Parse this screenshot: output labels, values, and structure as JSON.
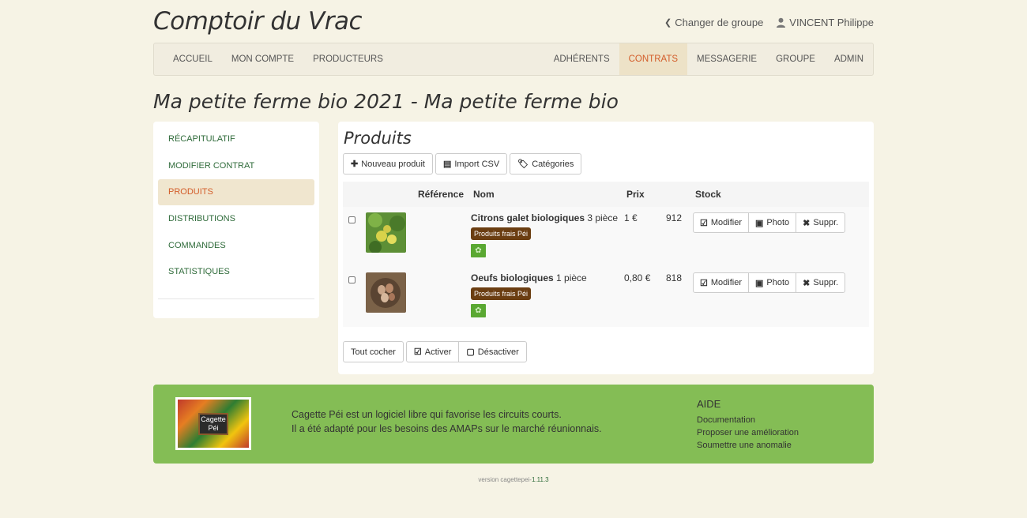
{
  "brand": "Comptoir du Vrac",
  "top_links": {
    "change_group": "Changer de groupe",
    "user": "VINCENT Philippe"
  },
  "nav": {
    "left": [
      "ACCUEIL",
      "MON COMPTE",
      "PRODUCTEURS"
    ],
    "right": [
      "ADHÉRENTS",
      "CONTRATS",
      "MESSAGERIE",
      "GROUPE",
      "ADMIN"
    ],
    "active": "CONTRATS"
  },
  "page_title": "Ma petite ferme bio 2021 - Ma petite ferme bio",
  "sidebar": {
    "items": [
      "RÉCAPITULATIF",
      "MODIFIER CONTRAT",
      "PRODUITS",
      "DISTRIBUTIONS",
      "COMMANDES",
      "STATISTIQUES"
    ],
    "active": "PRODUITS"
  },
  "products_section": {
    "title": "Produits",
    "toolbar": {
      "new_product": "Nouveau produit",
      "import_csv": "Import CSV",
      "categories": "Catégories"
    },
    "columns": {
      "ref": "Référence",
      "name": "Nom",
      "price": "Prix",
      "stock": "Stock"
    },
    "rows": [
      {
        "name": "Citrons galet biologiques",
        "qty": "3 pièce",
        "badge": "Produits frais Péi",
        "price": "1 €",
        "stock": "912",
        "thumb_color": "#6d9b3c"
      },
      {
        "name": "Oeufs biologiques",
        "qty": "1 pièce",
        "badge": "Produits frais Péi",
        "price": "0,80 €",
        "stock": "818",
        "thumb_color": "#8a6b4f"
      }
    ],
    "row_actions": {
      "edit": "Modifier",
      "photo": "Photo",
      "delete": "Suppr."
    },
    "bottom": {
      "check_all": "Tout cocher",
      "activate": "Activer",
      "deactivate": "Désactiver"
    }
  },
  "footer": {
    "logo_text_1": "Cagette",
    "logo_text_2": "Péi",
    "line1": "Cagette Péi est un logiciel libre qui favorise les circuits courts.",
    "line2": "Il a été adapté pour les besoins des AMAPs sur le marché réunionnais.",
    "help_title": "AIDE",
    "help_links": [
      "Documentation",
      "Proposer une amélioration",
      "Soumettre une anomalie"
    ]
  },
  "version": {
    "label": "version cagettepei-",
    "number": "1.11.3"
  },
  "colors": {
    "accent": "#d35d2a",
    "footer_bg": "#84bd55",
    "link_green": "#2f6b3a",
    "badge": "#6b3e12"
  }
}
